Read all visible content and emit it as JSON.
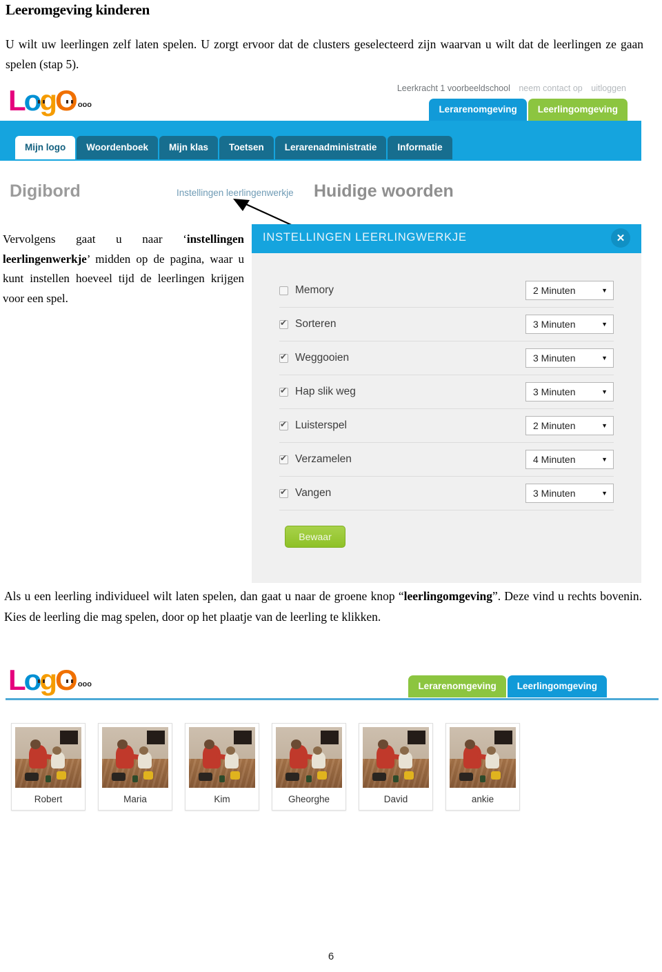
{
  "document": {
    "title": "Leeromgeving kinderen",
    "intro_paragraph": "U wilt uw leerlingen zelf laten spelen. U zorgt ervoor dat de clusters geselecteerd zijn waarvan u wilt dat de leerlingen ze gaan spelen (stap 5).",
    "side_paragraph_pre": "Vervolgens gaat u naar ‘",
    "side_paragraph_bold": "instellingen leerlingenwerkje",
    "side_paragraph_post": "’ midden op de pagina, waar u kunt instellen hoeveel tijd de leerlingen krijgen voor een spel.",
    "mid_paragraph_pre": "Als u een leerling individueel wilt laten spelen, dan gaat u naar de groene knop “",
    "mid_paragraph_bold": "leerlingomgeving",
    "mid_paragraph_post": "”. Deze vind u rechts bovenin. Kies de leerling die mag spelen, door op het plaatje van de leerling te klikken.",
    "page_number": "6"
  },
  "screenshot_top": {
    "logo": {
      "letters": [
        "L",
        "o",
        "g",
        "O"
      ],
      "dots": "ooo"
    },
    "user_bar": {
      "user_name": "Leerkracht 1 voorbeeldschool",
      "contact_link": "neem contact op",
      "logout_link": "uitloggen"
    },
    "env_tabs": [
      {
        "label": "Lerarenomgeving",
        "style": "blue",
        "color": "#119ad8"
      },
      {
        "label": "Leerlingomgeving",
        "style": "green",
        "color": "#8cc540"
      }
    ],
    "nav_tabs": [
      {
        "label": "Mijn logo",
        "active": true
      },
      {
        "label": "Woordenboek",
        "active": false
      },
      {
        "label": "Mijn klas",
        "active": false
      },
      {
        "label": "Toetsen",
        "active": false
      },
      {
        "label": "Lerarenadministratie",
        "active": false
      },
      {
        "label": "Informatie",
        "active": false
      }
    ],
    "sections": {
      "digibord": "Digibord",
      "settings_link": "Instellingen leerlingenwerkje",
      "current_words": "Huidige woorden"
    }
  },
  "dialog": {
    "title": "INSTELLINGEN LEERLINGWERKJE",
    "close_icon": "close-icon",
    "close_glyph": "✕",
    "header_color": "#15a4de",
    "options": [
      {
        "label": "Memory",
        "checked": false,
        "duration": "2 Minuten"
      },
      {
        "label": "Sorteren",
        "checked": true,
        "duration": "3 Minuten"
      },
      {
        "label": "Weggooien",
        "checked": true,
        "duration": "3 Minuten"
      },
      {
        "label": "Hap slik weg",
        "checked": true,
        "duration": "3 Minuten"
      },
      {
        "label": "Luisterspel",
        "checked": true,
        "duration": "2 Minuten"
      },
      {
        "label": "Verzamelen",
        "checked": true,
        "duration": "4 Minuten"
      },
      {
        "label": "Vangen",
        "checked": true,
        "duration": "3 Minuten"
      }
    ],
    "save_button": "Bewaar",
    "save_color": "#8ec127"
  },
  "screenshot_bottom": {
    "env_tabs": [
      {
        "label": "Lerarenomgeving",
        "style": "green",
        "color": "#8cc540"
      },
      {
        "label": "Leerlingomgeving",
        "style": "blue",
        "color": "#119ad8"
      }
    ],
    "students": [
      {
        "name": "Robert"
      },
      {
        "name": "Maria"
      },
      {
        "name": "Kim"
      },
      {
        "name": "Gheorghe"
      },
      {
        "name": "David"
      },
      {
        "name": "ankie"
      }
    ]
  }
}
